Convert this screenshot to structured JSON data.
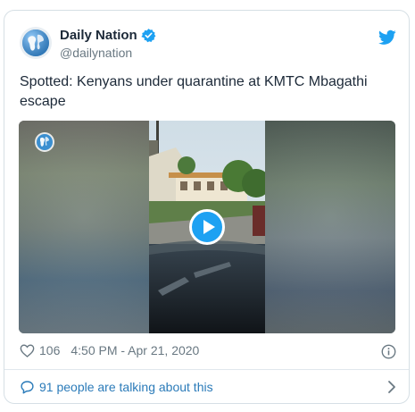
{
  "tweet": {
    "display_name": "Daily Nation",
    "handle": "@dailynation",
    "text": "Spotted: Kenyans under quarantine at KMTC Mbagathi escape",
    "likes": "106",
    "timestamp": "4:50 PM - Apr 21, 2020",
    "talking": "91 people are talking about this"
  },
  "colors": {
    "accent": "#1da1f2",
    "link": "#2b7bb9",
    "text": "#1c2938",
    "muted": "#697882"
  },
  "icons": [
    "avatar-globe-icon",
    "verified-icon",
    "twitter-bird-icon",
    "play-icon",
    "heart-icon",
    "info-icon",
    "speech-bubble-icon",
    "chevron-right-icon"
  ]
}
